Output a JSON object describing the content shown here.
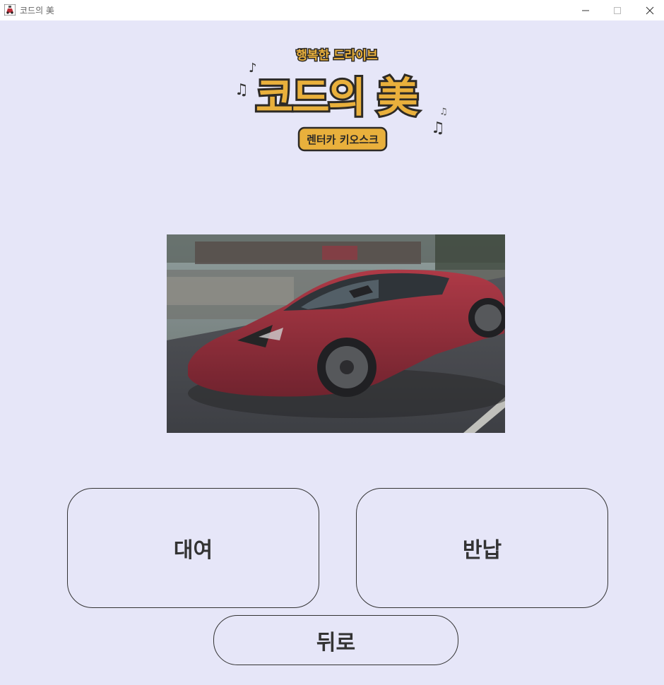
{
  "window": {
    "title": "코드의 美"
  },
  "logo": {
    "subtitle": "행복한 드라이브",
    "main": "코드의 美",
    "badge": "렌터카 키오스크",
    "colors": {
      "fill": "#e9b03c",
      "outline": "#2d2a26"
    }
  },
  "photo": {
    "subject": "red sports car"
  },
  "buttons": {
    "rent": "대여",
    "return": "반납",
    "back": "뒤로"
  },
  "colors": {
    "background": "#e6e6f8",
    "text": "#333333"
  }
}
